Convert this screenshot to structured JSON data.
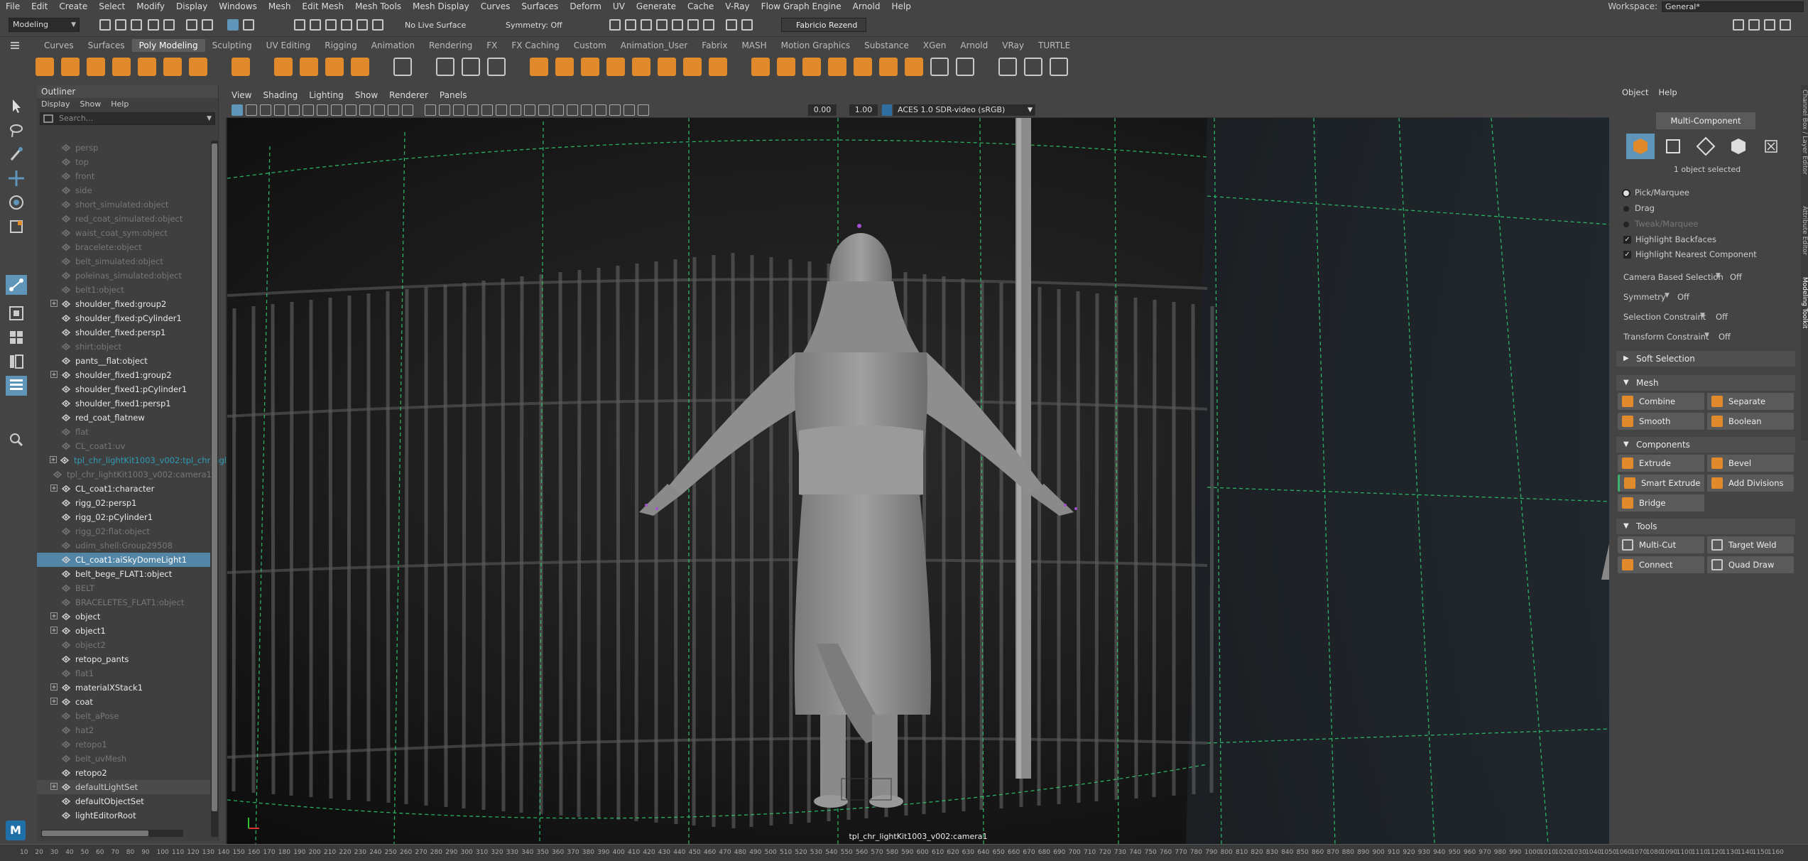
{
  "menubar": {
    "items": [
      "File",
      "Edit",
      "Create",
      "Select",
      "Modify",
      "Display",
      "Windows",
      "Mesh",
      "Edit Mesh",
      "Mesh Tools",
      "Mesh Display",
      "Curves",
      "Surfaces",
      "Deform",
      "UV",
      "Generate",
      "Cache",
      "V-Ray",
      "Flow Graph Engine",
      "Arnold",
      "Help"
    ],
    "workspace_label": "Workspace:",
    "workspace_value": "General*"
  },
  "statusline": {
    "mode": "Modeling",
    "live_surface": "No Live Surface",
    "symmetry": "Symmetry: Off",
    "user": "Fabricio Rezend"
  },
  "shelf": {
    "tabs": [
      "Curves",
      "Surfaces",
      "Poly Modeling",
      "Sculpting",
      "UV Editing",
      "Rigging",
      "Animation",
      "Rendering",
      "FX",
      "FX Caching",
      "Custom",
      "Animation_User",
      "Fabrix",
      "MASH",
      "Motion Graphics",
      "Substance",
      "XGen",
      "Arnold",
      "VRay",
      "TURTLE"
    ],
    "active_tab": "Poly Modeling"
  },
  "outliner": {
    "title": "Outliner",
    "menu": [
      "Display",
      "Show",
      "Help"
    ],
    "search_placeholder": "Search...",
    "items": [
      {
        "label": "persp",
        "style": "dim",
        "expand": ""
      },
      {
        "label": "top",
        "style": "dim",
        "expand": ""
      },
      {
        "label": "front",
        "style": "dim",
        "expand": ""
      },
      {
        "label": "side",
        "style": "dim",
        "expand": ""
      },
      {
        "label": "short_simulated:object",
        "style": "dim",
        "expand": ""
      },
      {
        "label": "red_coat_simulated:object",
        "style": "dim",
        "expand": ""
      },
      {
        "label": "waist_coat_sym:object",
        "style": "dim",
        "expand": ""
      },
      {
        "label": "bracelete:object",
        "style": "dim",
        "expand": ""
      },
      {
        "label": "belt_simulated:object",
        "style": "dim",
        "expand": ""
      },
      {
        "label": "poleinas_simulated:object",
        "style": "dim",
        "expand": ""
      },
      {
        "label": "belt1:object",
        "style": "dim",
        "expand": ""
      },
      {
        "label": "shoulder_fixed:group2",
        "style": "white",
        "expand": "+"
      },
      {
        "label": "shoulder_fixed:pCylinder1",
        "style": "white",
        "expand": ""
      },
      {
        "label": "shoulder_fixed:persp1",
        "style": "white",
        "expand": ""
      },
      {
        "label": "shirt:object",
        "style": "dim",
        "expand": ""
      },
      {
        "label": "pants__flat:object",
        "style": "white",
        "expand": ""
      },
      {
        "label": "shoulder_fixed1:group2",
        "style": "white",
        "expand": "+"
      },
      {
        "label": "shoulder_fixed1:pCylinder1",
        "style": "white",
        "expand": ""
      },
      {
        "label": "shoulder_fixed1:persp1",
        "style": "white",
        "expand": ""
      },
      {
        "label": "red_coat_flatnew",
        "style": "white",
        "expand": ""
      },
      {
        "label": "flat",
        "style": "dim",
        "expand": ""
      },
      {
        "label": "CL_coat1:uv",
        "style": "dim",
        "expand": ""
      },
      {
        "label": "tpl_chr_lightKit1003_v002:tpl_chr_ligh",
        "style": "cyan",
        "expand": "+"
      },
      {
        "label": "tpl_chr_lightKit1003_v002:camera1",
        "style": "dim",
        "expand": ""
      },
      {
        "label": "CL_coat1:character",
        "style": "white",
        "expand": "+"
      },
      {
        "label": "rigg_02:persp1",
        "style": "white",
        "expand": ""
      },
      {
        "label": "rigg_02:pCylinder1",
        "style": "white",
        "expand": ""
      },
      {
        "label": "rigg_02:flat:object",
        "style": "dim",
        "expand": ""
      },
      {
        "label": "udim_shell:Group29508",
        "style": "dim",
        "expand": ""
      },
      {
        "label": "CL_coat1:aiSkyDomeLight1",
        "style": "sel",
        "expand": ""
      },
      {
        "label": "belt_bege_FLAT1:object",
        "style": "white",
        "expand": ""
      },
      {
        "label": "BELT",
        "style": "dim",
        "expand": ""
      },
      {
        "label": "BRACELETES_FLAT1:object",
        "style": "dim",
        "expand": ""
      },
      {
        "label": "object",
        "style": "white",
        "expand": "+"
      },
      {
        "label": "object1",
        "style": "white",
        "expand": "+"
      },
      {
        "label": "object2",
        "style": "dim",
        "expand": ""
      },
      {
        "label": "retopo_pants",
        "style": "white",
        "expand": ""
      },
      {
        "label": "flat1",
        "style": "dim",
        "expand": ""
      },
      {
        "label": "materialXStack1",
        "style": "white",
        "expand": "+"
      },
      {
        "label": "coat",
        "style": "white",
        "expand": "+"
      },
      {
        "label": "belt_aPose",
        "style": "dim",
        "expand": ""
      },
      {
        "label": "hat2",
        "style": "dim",
        "expand": ""
      },
      {
        "label": "retopo1",
        "style": "dim",
        "expand": ""
      },
      {
        "label": "belt_uvMesh",
        "style": "dim",
        "expand": ""
      },
      {
        "label": "retopo2",
        "style": "white",
        "expand": ""
      },
      {
        "label": "defaultLightSet",
        "style": "sel2",
        "expand": "+"
      },
      {
        "label": "defaultObjectSet",
        "style": "white",
        "expand": ""
      },
      {
        "label": "lightEditorRoot",
        "style": "white",
        "expand": ""
      }
    ]
  },
  "viewport": {
    "menu": [
      "View",
      "Shading",
      "Lighting",
      "Show",
      "Renderer",
      "Panels"
    ],
    "exposure": "0.00",
    "gamma": "1.00",
    "color_space": "ACES 1.0 SDR-video (sRGB)",
    "camera_label": "tpl_chr_lightKit1003_v002:camera1"
  },
  "modeling_toolkit": {
    "menu": [
      "Object",
      "Help"
    ],
    "mode_button": "Multi-Component",
    "selection_status": "1 object selected",
    "pick_marquee": "Pick/Marquee",
    "drag": "Drag",
    "tweak_marquee": "Tweak/Marquee",
    "highlight_backfaces": "Highlight Backfaces",
    "highlight_nearest": "Highlight Nearest Component",
    "camera_based_selection": {
      "label": "Camera Based Selection",
      "value": "Off"
    },
    "symmetry": {
      "label": "Symmetry",
      "value": "Off"
    },
    "selection_constraint": {
      "label": "Selection Constraint",
      "value": "Off"
    },
    "transform_constraint": {
      "label": "Transform Constraint",
      "value": "Off"
    },
    "soft_selection": "Soft Selection",
    "sections": {
      "mesh": "Mesh",
      "components": "Components",
      "tools": "Tools"
    },
    "mesh_buttons": [
      "Combine",
      "Separate",
      "Smooth",
      "Boolean"
    ],
    "component_buttons": [
      "Extrude",
      "Bevel",
      "Smart Extrude",
      "Add Divisions",
      "Bridge"
    ],
    "tool_buttons": [
      "Multi-Cut",
      "Target Weld",
      "Connect",
      "Quad Draw"
    ]
  },
  "side_tabs": [
    "Channel Box / Layer Editor",
    "Attribute Editor",
    "Modeling Toolkit"
  ],
  "ruler": {
    "ticks": [
      "10",
      "20",
      "30",
      "40",
      "50",
      "60",
      "70",
      "80",
      "90",
      "100",
      "110",
      "120",
      "130",
      "140",
      "150",
      "160",
      "170",
      "180",
      "190",
      "200",
      "210",
      "220",
      "230",
      "240",
      "250",
      "260",
      "270",
      "280",
      "290",
      "300",
      "310",
      "320",
      "330",
      "340",
      "350",
      "360",
      "370",
      "380",
      "390",
      "400",
      "410",
      "420",
      "430",
      "440",
      "450",
      "460",
      "470",
      "480",
      "490",
      "500",
      "510",
      "520",
      "530",
      "540",
      "550",
      "560",
      "570",
      "580",
      "590",
      "600",
      "610",
      "620",
      "630",
      "640",
      "650",
      "660",
      "670",
      "680",
      "690",
      "700",
      "710",
      "720",
      "730",
      "740",
      "750",
      "760",
      "770",
      "780",
      "790",
      "800",
      "810",
      "820",
      "830",
      "840",
      "850",
      "860",
      "870",
      "880",
      "890",
      "900",
      "910",
      "920",
      "930",
      "940",
      "950",
      "960",
      "970",
      "980",
      "990",
      "1000",
      "1010",
      "1020",
      "1030",
      "1040",
      "1050",
      "1060",
      "1070",
      "1080",
      "1090",
      "1100",
      "1110",
      "1120",
      "1130",
      "1140",
      "1150",
      "1160"
    ]
  },
  "colors": {
    "accent": "#5285a6",
    "shelf_orange": "#e08a2c",
    "grid": "#2ecc71"
  }
}
